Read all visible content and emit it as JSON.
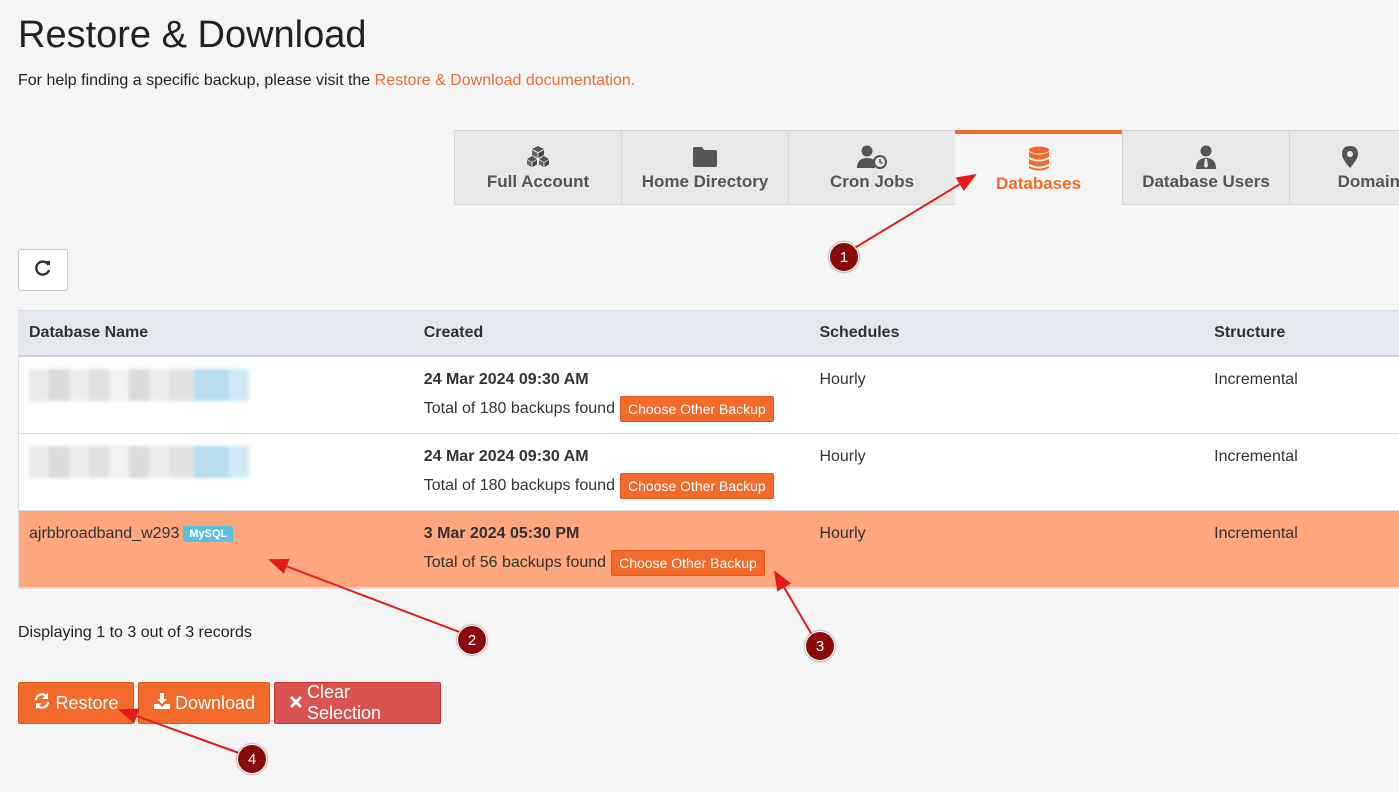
{
  "page": {
    "title": "Restore & Download",
    "help_prefix": "For help finding a specific backup, please visit the ",
    "help_link": "Restore & Download documentation."
  },
  "tabs": [
    {
      "label": "Full Account",
      "icon": "cubes-icon",
      "active": false
    },
    {
      "label": "Home Directory",
      "icon": "folder-icon",
      "active": false
    },
    {
      "label": "Cron Jobs",
      "icon": "user-clock-icon",
      "active": false
    },
    {
      "label": "Databases",
      "icon": "database-icon",
      "active": true
    },
    {
      "label": "Database Users",
      "icon": "user-tie-icon",
      "active": false
    },
    {
      "label": "Domains",
      "icon": "map-marker-icon",
      "active": false
    }
  ],
  "table": {
    "headers": [
      "Database Name",
      "Created",
      "Schedules",
      "Structure"
    ],
    "rows": [
      {
        "name": "",
        "badge": "",
        "date": "24 Mar 2024 09:30 AM",
        "backups": "Total of 180 backups found",
        "choose": "Choose Other Backup",
        "schedule": "Hourly",
        "structure": "Incremental",
        "selected": false
      },
      {
        "name": "",
        "badge": "",
        "date": "24 Mar 2024 09:30 AM",
        "backups": "Total of 180 backups found",
        "choose": "Choose Other Backup",
        "schedule": "Hourly",
        "structure": "Incremental",
        "selected": false
      },
      {
        "name": "ajrbbroadband_w293",
        "badge": "MySQL",
        "date": "3 Mar 2024 05:30 PM",
        "backups": "Total of 56 backups found",
        "choose": "Choose Other Backup",
        "schedule": "Hourly",
        "structure": "Incremental",
        "selected": true
      }
    ]
  },
  "records": "Displaying 1 to 3 out of 3 records",
  "actions": {
    "restore": "Restore",
    "download": "Download",
    "clear": "Clear Selection"
  },
  "annotations": [
    "1",
    "2",
    "3",
    "4"
  ],
  "colors": {
    "accent": "#f26b2d",
    "danger": "#d9534f",
    "selected_row": "#ffa77f",
    "badge": "#5bc0de",
    "marker": "#8b0a0a"
  }
}
